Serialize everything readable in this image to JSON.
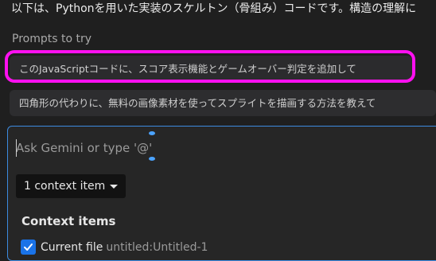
{
  "response_text": "以下は、Pythonを用いた実装のスケルトン（骨組み）コードです。構造の理解に",
  "prompts_header": "Prompts to try",
  "prompts": [
    "このJavaScriptコードに、スコア表示機能とゲームオーバー判定を追加して",
    "四角形の代わりに、無料の画像素材を使ってスプライトを描画する方法を教えて"
  ],
  "input": {
    "placeholder": "Ask Gemini or type '@'",
    "value": ""
  },
  "context": {
    "dropdown_label": "1 context item",
    "heading": "Context items",
    "file_name": "Current file",
    "file_path": "untitled:Untitled-1",
    "file_checked": true
  },
  "colors": {
    "accent": "#1a73e8",
    "focus_border": "#3c8be0",
    "highlight": "#ff10f0"
  },
  "icons": [
    "chevron-down-icon",
    "checkmark-icon"
  ]
}
